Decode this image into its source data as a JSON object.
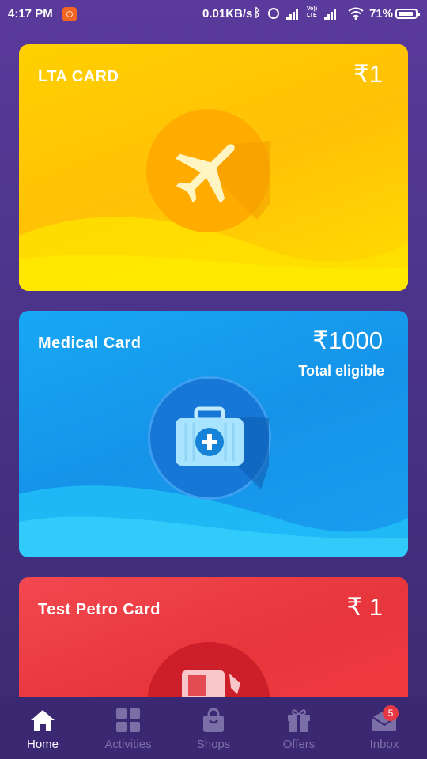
{
  "status_bar": {
    "time": "4:17 PM",
    "network_speed": "0.01KB/s",
    "volte": "Vo)) LTE",
    "battery_percent": "71%",
    "icons": [
      "app-notification-icon",
      "bluetooth-icon",
      "alarm-icon",
      "signal-icon",
      "volte-icon",
      "signal-icon",
      "wifi-icon",
      "battery-icon"
    ]
  },
  "cards": {
    "lta": {
      "title": "LTA CARD",
      "amount": "₹1",
      "icon": "airplane-icon",
      "color": "#ffc107"
    },
    "medical": {
      "title": "Medical Card",
      "amount": "₹1000",
      "subtitle": "Total eligible",
      "icon": "medical-kit-icon",
      "color": "#1593e8"
    },
    "petro": {
      "title": "Test Petro Card",
      "amount": "₹ 1",
      "icon": "fuel-icon",
      "color": "#e8363d"
    }
  },
  "bottom_nav": {
    "items": [
      {
        "label": "Home",
        "icon": "home-icon",
        "active": true
      },
      {
        "label": "Activities",
        "icon": "grid-icon",
        "active": false
      },
      {
        "label": "Shops",
        "icon": "shopping-bag-icon",
        "active": false
      },
      {
        "label": "Offers",
        "icon": "gift-icon",
        "active": false
      },
      {
        "label": "Inbox",
        "icon": "mail-icon",
        "active": false,
        "badge": "5"
      }
    ],
    "active_color": "#ffffff",
    "inactive_color": "#7a6fa6"
  }
}
